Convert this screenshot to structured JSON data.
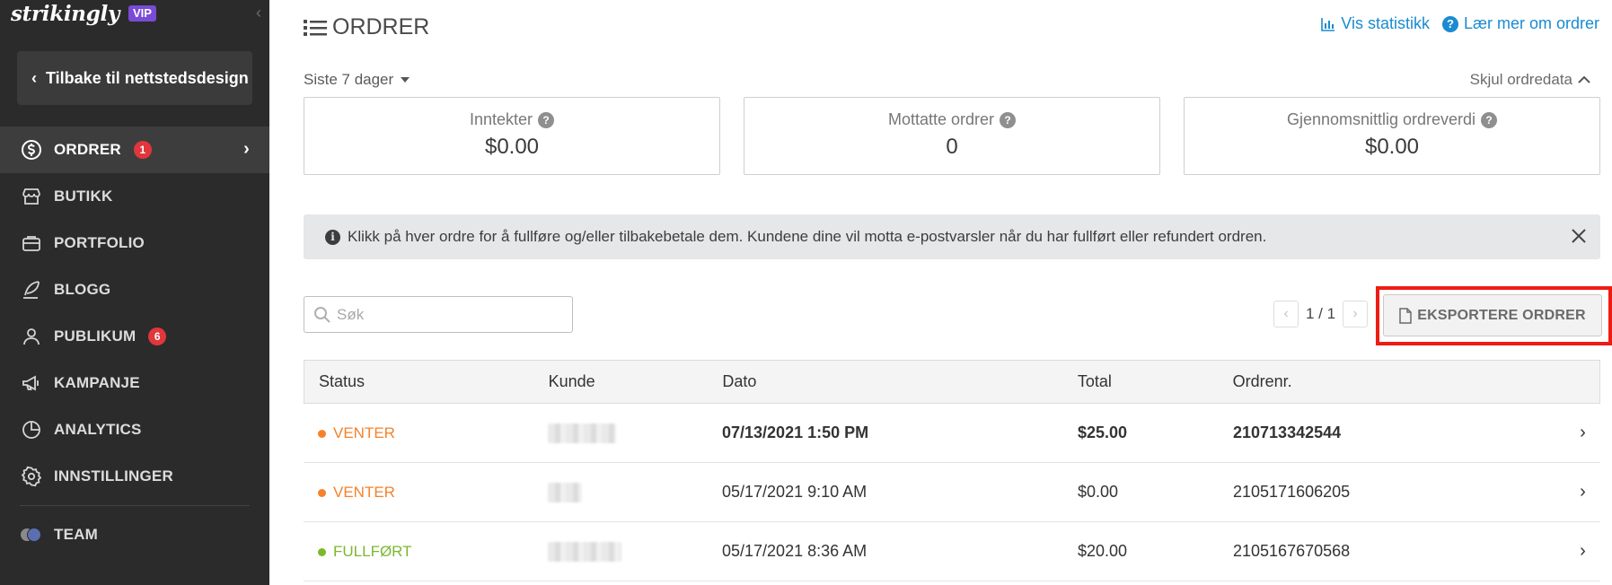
{
  "sidebar": {
    "brand": "strikingly",
    "vip": "VIP",
    "back_label": "Tilbake til nettstedsdesign",
    "items": [
      {
        "label": "ORDRER",
        "badge": "1",
        "icon": "dollar-circle-icon"
      },
      {
        "label": "BUTIKK",
        "badge": "",
        "icon": "store-icon"
      },
      {
        "label": "PORTFOLIO",
        "badge": "",
        "icon": "briefcase-icon"
      },
      {
        "label": "BLOGG",
        "badge": "",
        "icon": "quill-icon"
      },
      {
        "label": "PUBLIKUM",
        "badge": "6",
        "icon": "audience-icon"
      },
      {
        "label": "KAMPANJE",
        "badge": "",
        "icon": "megaphone-icon"
      },
      {
        "label": "ANALYTICS",
        "badge": "",
        "icon": "pie-chart-icon"
      },
      {
        "label": "INNSTILLINGER",
        "badge": "",
        "icon": "gear-icon"
      },
      {
        "label": "TEAM",
        "badge": "",
        "icon": "team-avatar-icon"
      }
    ]
  },
  "header": {
    "title": "ORDRER",
    "stats_link": "Vis statistikk",
    "learn_link": "Lær mer om ordrer"
  },
  "filters": {
    "period": "Siste 7 dager",
    "hide_data": "Skjul ordredata"
  },
  "stats": [
    {
      "label": "Inntekter",
      "value": "$0.00"
    },
    {
      "label": "Mottatte ordrer",
      "value": "0"
    },
    {
      "label": "Gjennomsnittlig ordreverdi",
      "value": "$0.00"
    }
  ],
  "info": {
    "text": "Klikk på hver ordre for å fullføre og/eller tilbakebetale dem. Kundene dine vil motta e-postvarsler når du har fullført eller refundert ordren."
  },
  "search": {
    "placeholder": "Søk",
    "value": ""
  },
  "pager": {
    "label": "1 / 1"
  },
  "export": {
    "label": "EKSPORTERE ORDRER"
  },
  "table": {
    "headers": [
      "Status",
      "Kunde",
      "Dato",
      "Total",
      "Ordrenr."
    ],
    "rows": [
      {
        "status": "VENTER",
        "status_color": "#f5822a",
        "date": "07/13/2021 1:50 PM",
        "total": "$25.00",
        "order_no": "210713342544",
        "bold": true
      },
      {
        "status": "VENTER",
        "status_color": "#f5822a",
        "date": "05/17/2021 9:10 AM",
        "total": "$0.00",
        "order_no": "2105171606205",
        "bold": false
      },
      {
        "status": "FULLFØRT",
        "status_color": "#7cb82f",
        "date": "05/17/2021 8:36 AM",
        "total": "$20.00",
        "order_no": "2105167670568",
        "bold": false
      }
    ]
  },
  "colors": {
    "sidebar_bg": "#2b2b2b",
    "accent_link": "#1a8bd0",
    "pending": "#f5822a",
    "completed": "#7cb82f",
    "badge": "#e0363c",
    "highlight": "#ef1c13"
  }
}
